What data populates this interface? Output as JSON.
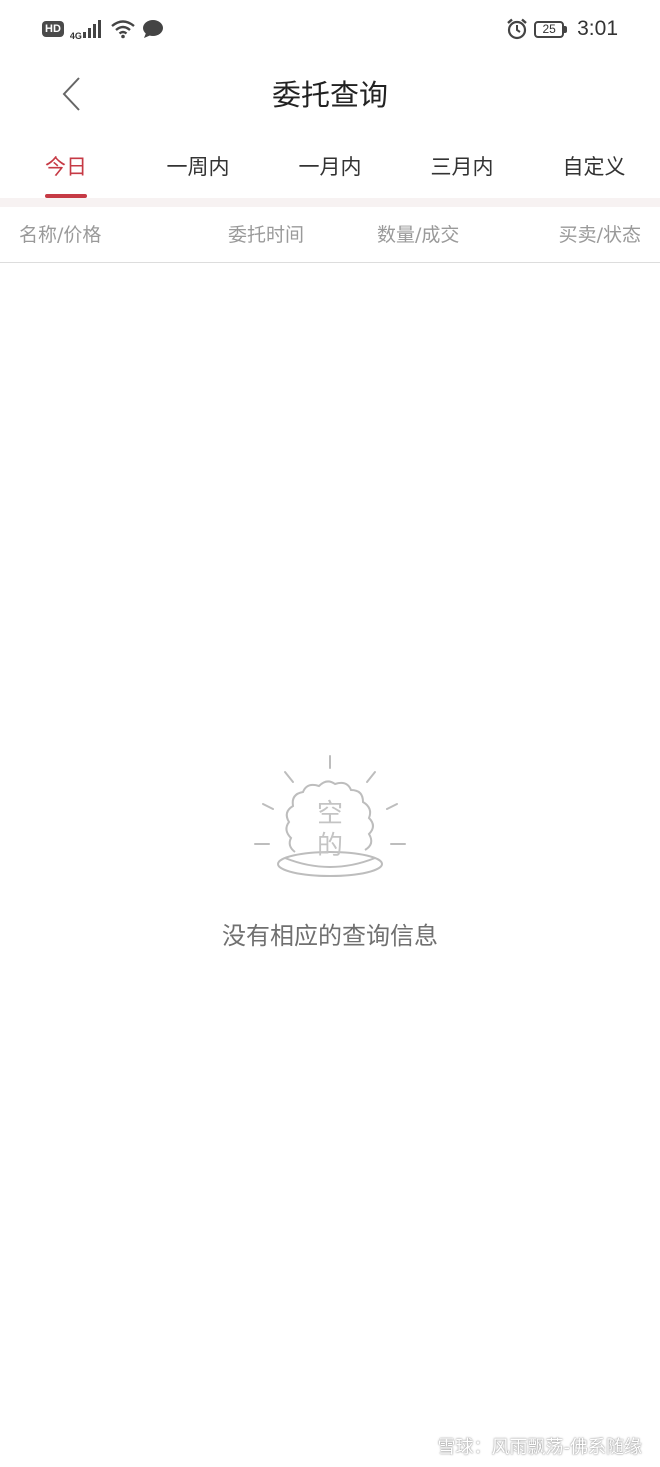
{
  "status_bar": {
    "left_icons": [
      "hd-badge",
      "signal-icon",
      "wifi-icon",
      "chat-bubble-icon"
    ],
    "hd_label": "HD",
    "network_label": "4G",
    "battery_level": "25",
    "time": "3:01"
  },
  "header": {
    "title": "委托查询"
  },
  "tabs": [
    {
      "label": "今日",
      "active": true
    },
    {
      "label": "一周内",
      "active": false
    },
    {
      "label": "一月内",
      "active": false
    },
    {
      "label": "三月内",
      "active": false
    },
    {
      "label": "自定义",
      "active": false
    }
  ],
  "columns": {
    "name_price": "名称/价格",
    "order_time": "委托时间",
    "qty_filled": "数量/成交",
    "side_status": "买卖/状态"
  },
  "empty_state": {
    "illustration_text_top": "空",
    "illustration_text_bottom": "的",
    "message": "没有相应的查询信息"
  },
  "watermark": {
    "text": "雪球：风雨飘荡-佛系随缘"
  },
  "colors": {
    "accent": "#c63a45",
    "muted_text": "#9a9a9a",
    "separator": "#f7f2f2"
  }
}
